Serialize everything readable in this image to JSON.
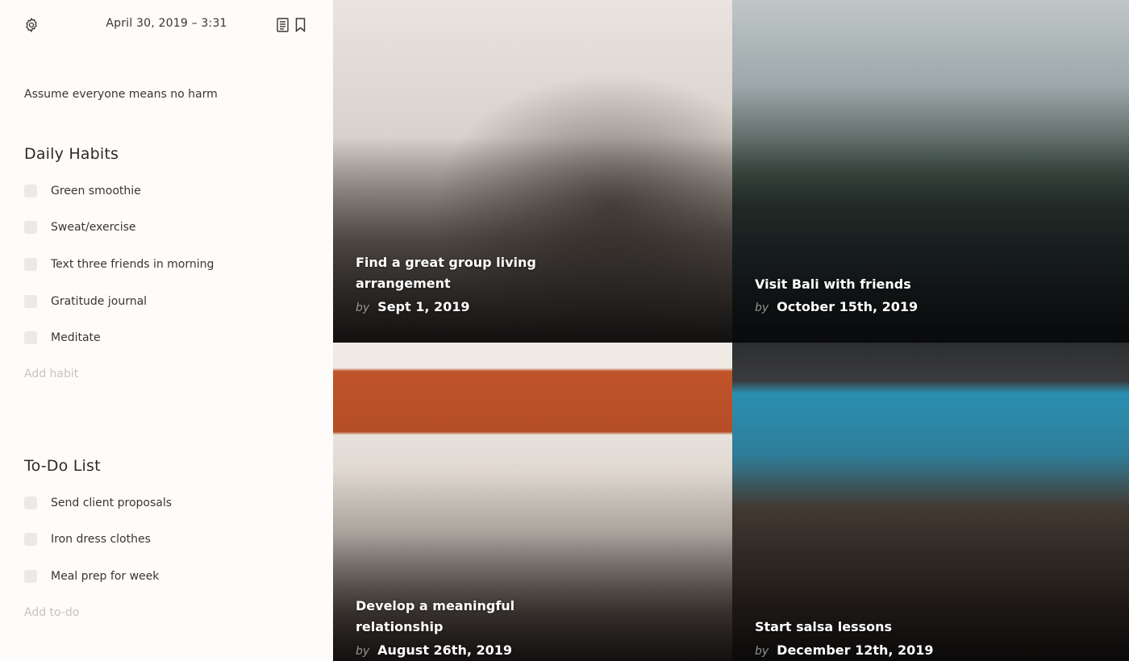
{
  "header": {
    "datetime": "April 30, 2019 – 3:31"
  },
  "icons": {
    "settings": "gear-icon",
    "notes": "notes-icon",
    "bookmark": "bookmark-icon"
  },
  "quote": "Assume everyone means no harm",
  "daily_habits": {
    "title": "Daily Habits",
    "items": [
      {
        "label": "Green smoothie",
        "checked": false
      },
      {
        "label": "Sweat/exercise",
        "checked": false
      },
      {
        "label": "Text three friends in morning",
        "checked": false
      },
      {
        "label": "Gratitude journal",
        "checked": false
      },
      {
        "label": "Meditate",
        "checked": false
      }
    ],
    "add_label": "Add habit"
  },
  "todo": {
    "title": "To-Do List",
    "items": [
      {
        "label": "Send client proposals",
        "checked": false
      },
      {
        "label": "Iron dress clothes",
        "checked": false
      },
      {
        "label": "Meal prep for week",
        "checked": false
      }
    ],
    "add_label": "Add to-do"
  },
  "goals": [
    {
      "title": "Find a great group living arrangement",
      "by": "by",
      "date": "Sept 1, 2019"
    },
    {
      "title": "Visit Bali with friends",
      "by": "by",
      "date": "October 15th, 2019"
    },
    {
      "title": "Develop a meaningful relationship",
      "by": "by",
      "date": "August 26th, 2019"
    },
    {
      "title": "Start salsa lessons",
      "by": "by",
      "date": "December 12th, 2019"
    }
  ],
  "colors": {
    "sidebar_bg": "#fdfcfb",
    "text": "#3c3431",
    "muted": "#c9c3bf",
    "checkbox": "#eceae6"
  }
}
